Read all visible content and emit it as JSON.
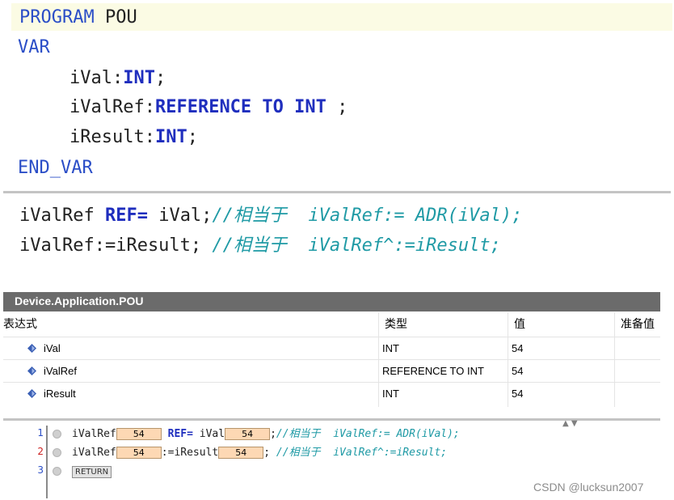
{
  "declaration": {
    "program_kw": "PROGRAM",
    "pou_name": "POU",
    "var_kw": "VAR",
    "vars": [
      {
        "name": "iVal",
        "sep": ":",
        "type": "INT",
        "end": ";"
      },
      {
        "name": "iValRef",
        "sep": ":",
        "type": "REFERENCE TO INT",
        "end": " ;"
      },
      {
        "name": "iResult",
        "sep": ":",
        "type": "INT",
        "end": ";"
      }
    ],
    "end_var_kw": "END_VAR"
  },
  "implementation": {
    "line1": {
      "ident": "iValRef ",
      "op": "REF=",
      "rest": " iVal;",
      "comment": "//相当于  iValRef:= ADR(iVal);"
    },
    "line2": {
      "code": "iValRef:=iResult; ",
      "comment": "//相当于  iValRef^:=iResult;"
    }
  },
  "watch": {
    "title": "Device.Application.POU",
    "columns": {
      "expression": "表达式",
      "type": "类型",
      "value": "值",
      "prepared": "准备值"
    },
    "rows": [
      {
        "name": "iVal",
        "type": "INT",
        "value": "54"
      },
      {
        "name": "iValRef",
        "type": "REFERENCE TO INT",
        "value": "54"
      },
      {
        "name": "iResult",
        "type": "INT",
        "value": "54"
      }
    ],
    "icon_color": "#3a5fb5"
  },
  "monitor": {
    "line_numbers": [
      "1",
      "2",
      "3"
    ],
    "line1": {
      "a": "iValRef",
      "a_val": "54",
      "op": " REF=",
      "b": " iVal",
      "b_val": "54",
      "tail": ";",
      "comment": "//相当于  iValRef:= ADR(iVal);"
    },
    "line2": {
      "a": "iValRef",
      "a_val": "54",
      "mid": ":=iResult",
      "b_val": "54",
      "tail": "; ",
      "comment": "//相当于  iValRef^:=iResult;"
    },
    "line3": {
      "return_label": "RETURN"
    }
  },
  "watermark": "CSDN @lucksun2007"
}
